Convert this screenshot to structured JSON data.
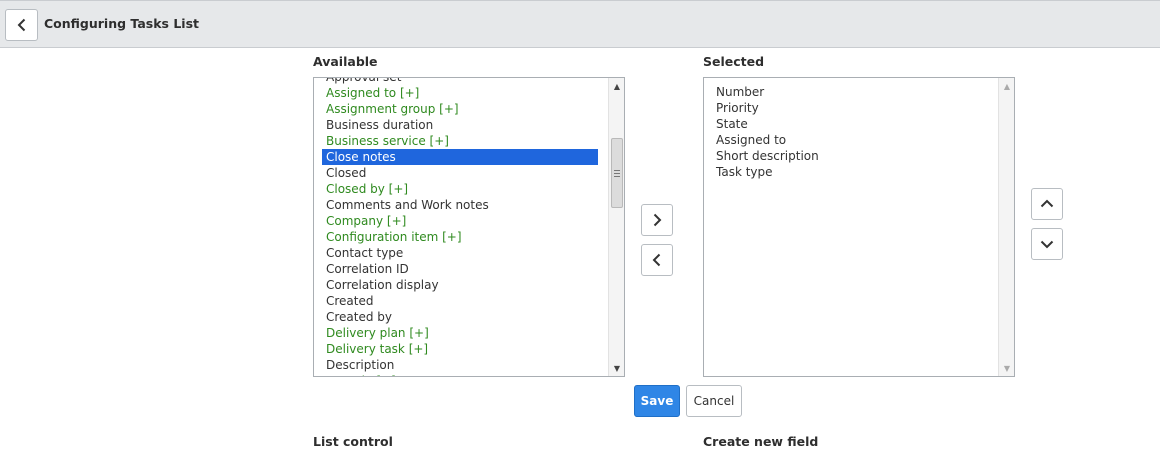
{
  "header": {
    "title": "Configuring Tasks List"
  },
  "available": {
    "label": "Available",
    "partial_top": "Approval set",
    "items": [
      {
        "label": "Assigned to [+]",
        "ref": true
      },
      {
        "label": "Assignment group [+]",
        "ref": true
      },
      {
        "label": "Business duration",
        "ref": false
      },
      {
        "label": "Business service [+]",
        "ref": true
      },
      {
        "label": "Close notes",
        "ref": false,
        "selected": true
      },
      {
        "label": "Closed",
        "ref": false
      },
      {
        "label": "Closed by [+]",
        "ref": true
      },
      {
        "label": "Comments and Work notes",
        "ref": false
      },
      {
        "label": "Company [+]",
        "ref": true
      },
      {
        "label": "Configuration item [+]",
        "ref": true
      },
      {
        "label": "Contact type",
        "ref": false
      },
      {
        "label": "Correlation ID",
        "ref": false
      },
      {
        "label": "Correlation display",
        "ref": false
      },
      {
        "label": "Created",
        "ref": false
      },
      {
        "label": "Created by",
        "ref": false
      },
      {
        "label": "Delivery plan [+]",
        "ref": true
      },
      {
        "label": "Delivery task [+]",
        "ref": true
      },
      {
        "label": "Description",
        "ref": false
      }
    ],
    "partial_bottom": "Domain [+]"
  },
  "selected": {
    "label": "Selected",
    "items": [
      "Number",
      "Priority",
      "State",
      "Assigned to",
      "Short description",
      "Task type"
    ]
  },
  "buttons": {
    "save": "Save",
    "cancel": "Cancel"
  },
  "below": {
    "left": "List control",
    "right": "Create new field"
  },
  "colors": {
    "reference": "#2f8a1f",
    "selection": "#1f66dd",
    "primary": "#2f86e6"
  }
}
